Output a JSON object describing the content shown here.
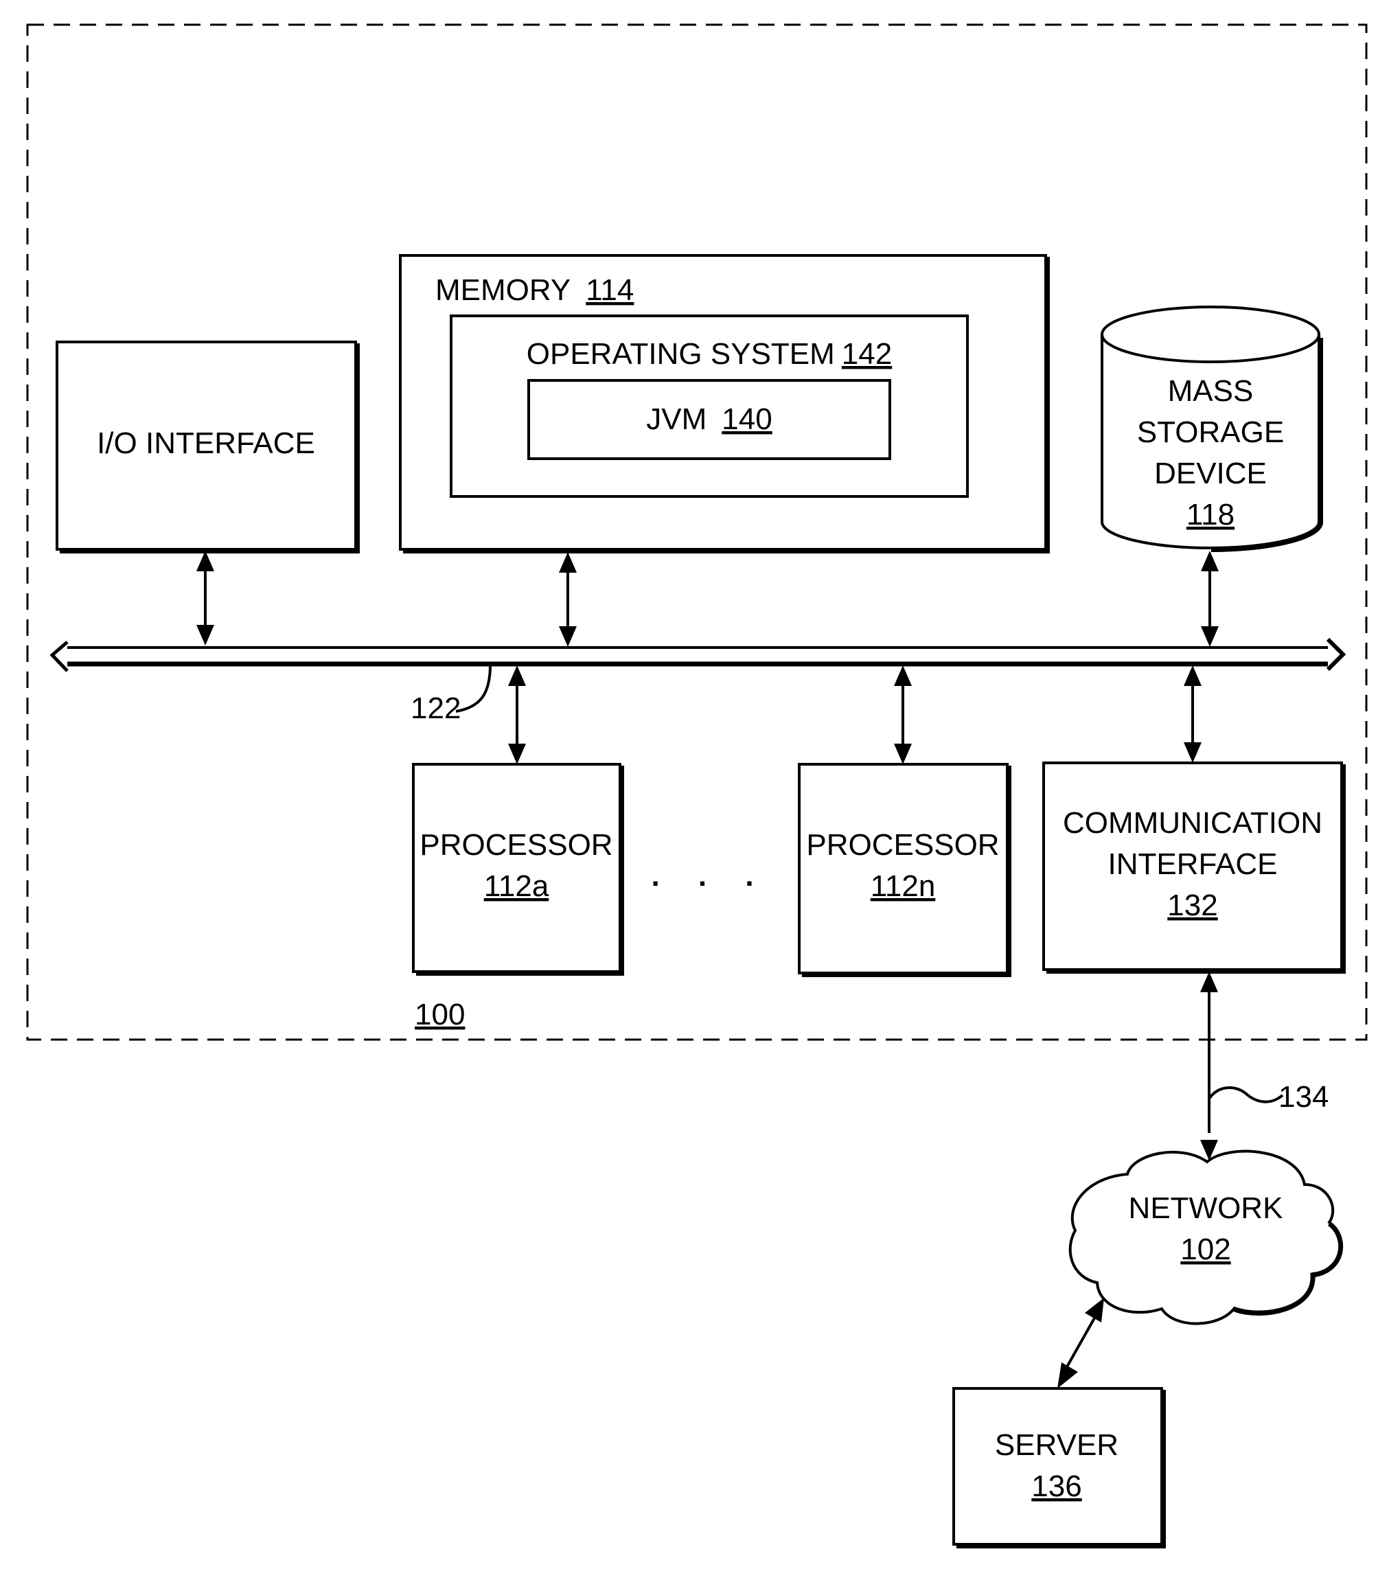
{
  "figure": {
    "system_ref": "100",
    "bus_ref": "122",
    "link_ref": "134",
    "ellipsis": ". . .",
    "blocks": {
      "io": {
        "label": "I/O INTERFACE"
      },
      "memory": {
        "label": "MEMORY",
        "ref": "114"
      },
      "os": {
        "label": "OPERATING SYSTEM",
        "ref": "142"
      },
      "jvm": {
        "label": "JVM",
        "ref": "140"
      },
      "storage": {
        "lines": [
          "MASS",
          "STORAGE",
          "DEVICE"
        ],
        "ref": "118"
      },
      "proc_a": {
        "label": "PROCESSOR",
        "ref": "112a"
      },
      "proc_n": {
        "label": "PROCESSOR",
        "ref": "112n"
      },
      "comm": {
        "lines": [
          "COMMUNICATION",
          "INTERFACE"
        ],
        "ref": "132"
      },
      "network": {
        "label": "NETWORK",
        "ref": "102"
      },
      "server": {
        "label": "SERVER",
        "ref": "136"
      }
    }
  }
}
